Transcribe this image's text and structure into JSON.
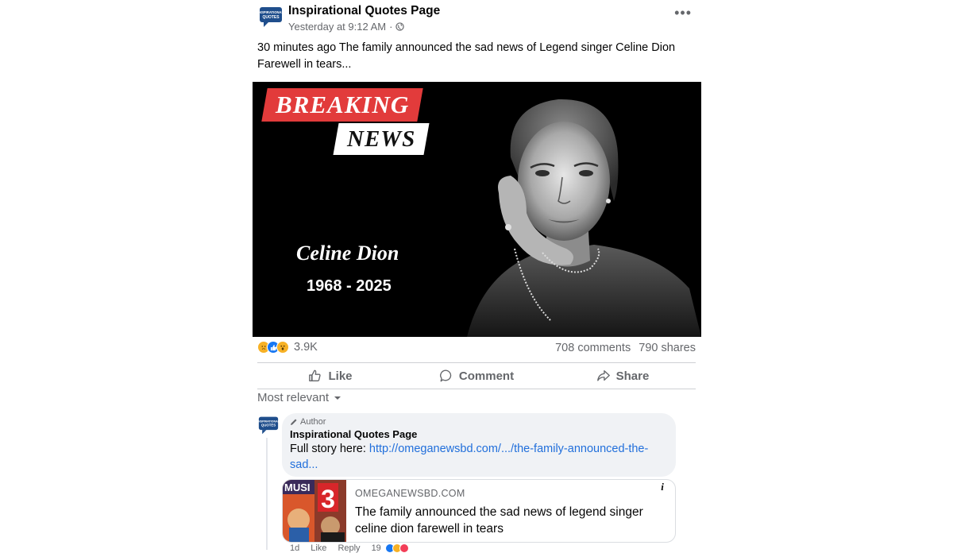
{
  "post": {
    "page_name": "Inspirational Quotes Page",
    "avatar_text": "INSPIRATIONAL QUOTES",
    "timestamp": "Yesterday at 9:12 AM",
    "separator": "·",
    "more_label": "•••",
    "text": "30 minutes ago  The family announced the sad news of Legend singer Celine Dion  Farewell in tears..."
  },
  "image": {
    "badge_top": "BREAKING",
    "badge_bottom": "NEWS",
    "name": "Celine Dion",
    "years": "1968 - 2025"
  },
  "stats": {
    "reactions_count": "3.9K",
    "reaction_icons": [
      "sad-icon",
      "like-icon",
      "wow-icon"
    ],
    "comments": "708 comments",
    "shares": "790 shares"
  },
  "actions": {
    "like": "Like",
    "comment": "Comment",
    "share": "Share"
  },
  "sort": {
    "label": "Most relevant"
  },
  "comment": {
    "badge": "Author",
    "name": "Inspirational Quotes Page",
    "prefix": "Full story here: ",
    "link": "http://omeganewsbd.com/.../the-family-announced-the-sad...",
    "card": {
      "domain": "OMEGANEWSBD.COM",
      "title": "The family announced the sad news of legend singer celine dion farewell in tears",
      "info": "i",
      "thumb_text": "MUSI"
    },
    "footer": {
      "age": "1d",
      "like": "Like",
      "reply": "Reply",
      "count": "19"
    }
  },
  "colors": {
    "link": "#216fdb",
    "breaking_red": "#e23b3b",
    "muted": "#65676b"
  }
}
